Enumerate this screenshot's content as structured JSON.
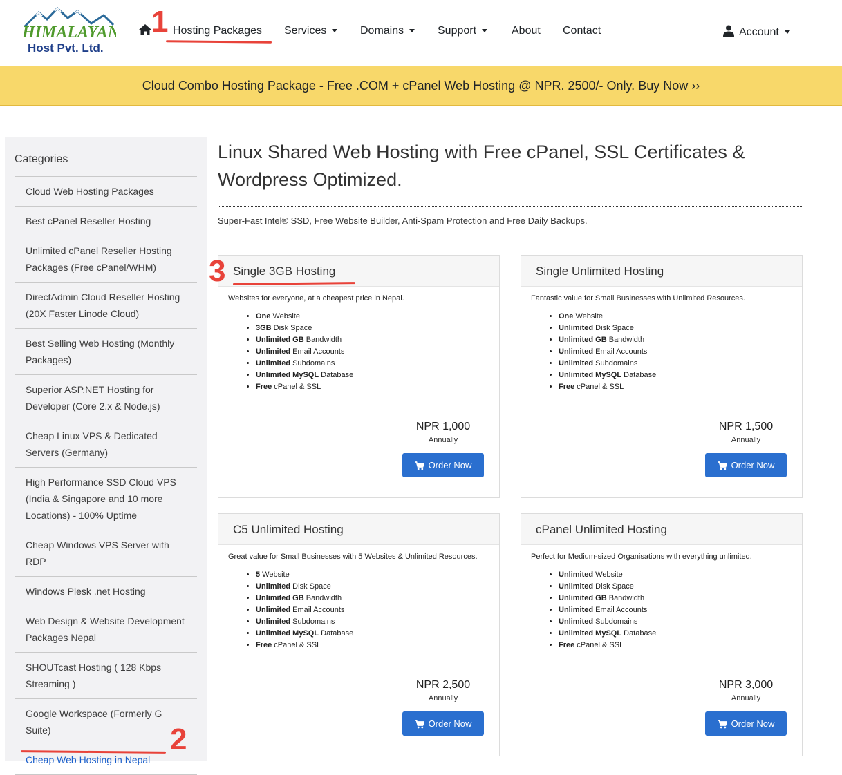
{
  "brand": {
    "logo_line1": "HIMALAYAN",
    "logo_line2": "Host Pvt. Ltd."
  },
  "nav": {
    "items": [
      {
        "label": "Hosting Packages",
        "dropdown": false
      },
      {
        "label": "Services",
        "dropdown": true
      },
      {
        "label": "Domains",
        "dropdown": true
      },
      {
        "label": "Support",
        "dropdown": true
      },
      {
        "label": "About",
        "dropdown": false
      },
      {
        "label": "Contact",
        "dropdown": false
      }
    ],
    "account": "Account",
    "home_icon": "home-icon",
    "account_icon": "user-icon"
  },
  "banner": {
    "text": "Cloud Combo Hosting Package - Free .COM + cPanel Web Hosting @ NPR. 2500/- Only. Buy Now ››"
  },
  "annotations": [
    "1",
    "2",
    "3"
  ],
  "sidebar": {
    "title": "Categories",
    "items": [
      "Cloud Web Hosting Packages",
      "Best cPanel Reseller Hosting",
      "Unlimited cPanel Reseller Hosting Packages (Free cPanel/WHM)",
      "DirectAdmin Cloud Reseller Hosting (20X Faster Linode Cloud)",
      "Best Selling Web Hosting (Monthly Packages)",
      "Superior ASP.NET Hosting for Developer (Core 2.x & Node.js)",
      "Cheap Linux VPS & Dedicated Servers (Germany)",
      "High Performance SSD Cloud VPS (India & Singapore and 10 more Locations) - 100% Uptime",
      "Cheap Windows VPS Server with RDP",
      "Windows Plesk .net Hosting",
      "Web Design & Website Development Packages Nepal",
      "SHOUTcast Hosting ( 128 Kbps Streaming )",
      "Google Workspace (Formerly G Suite)",
      "Cheap Web Hosting in Nepal"
    ],
    "active_index": 13
  },
  "main": {
    "title": "Linux Shared Web Hosting with Free cPanel, SSL Certificates & Wordpress Optimized.",
    "subtitle": "Super-Fast Intel® SSD, Free Website Builder, Anti-Spam Protection and Free Daily Backups."
  },
  "packages": [
    {
      "name": "Single 3GB Hosting",
      "desc": "Websites for everyone, at a cheapest price in Nepal.",
      "features": [
        [
          "One",
          " Website"
        ],
        [
          "3GB",
          " Disk Space"
        ],
        [
          "Unlimited GB",
          " Bandwidth"
        ],
        [
          "Unlimited",
          " Email Accounts"
        ],
        [
          "Unlimited",
          " Subdomains"
        ],
        [
          "Unlimited MySQL",
          " Database"
        ],
        [
          "Free",
          " cPanel & SSL"
        ]
      ],
      "price": "NPR 1,000",
      "cycle": "Annually",
      "button": "Order Now"
    },
    {
      "name": "Single Unlimited Hosting",
      "desc": "Fantastic value for Small Businesses with Unlimited Resources.",
      "features": [
        [
          "One",
          " Website"
        ],
        [
          "Unlimited",
          " Disk Space"
        ],
        [
          "Unlimited GB",
          " Bandwidth"
        ],
        [
          "Unlimited",
          " Email Accounts"
        ],
        [
          "Unlimited",
          " Subdomains"
        ],
        [
          "Unlimited MySQL",
          " Database"
        ],
        [
          "Free",
          " cPanel & SSL"
        ]
      ],
      "price": "NPR 1,500",
      "cycle": "Annually",
      "button": "Order Now"
    },
    {
      "name": "C5 Unlimited Hosting",
      "desc": "Great value for Small Businesses with 5 Websites & Unlimited Resources.",
      "features": [
        [
          "5",
          " Website"
        ],
        [
          "Unlimited",
          " Disk Space"
        ],
        [
          "Unlimited GB",
          " Bandwidth"
        ],
        [
          "Unlimited",
          " Email Accounts"
        ],
        [
          "Unlimited",
          " Subdomains"
        ],
        [
          "Unlimited MySQL",
          " Database"
        ],
        [
          "Free",
          " cPanel & SSL"
        ]
      ],
      "price": "NPR 2,500",
      "cycle": "Annually",
      "button": "Order Now"
    },
    {
      "name": "cPanel Unlimited Hosting",
      "desc": "Perfect for Medium-sized Organisations with everything unlimited.",
      "features": [
        [
          "Unlimited",
          " Website"
        ],
        [
          "Unlimited",
          " Disk Space"
        ],
        [
          "Unlimited GB",
          " Bandwidth"
        ],
        [
          "Unlimited",
          " Email Accounts"
        ],
        [
          "Unlimited",
          " Subdomains"
        ],
        [
          "Unlimited MySQL",
          " Database"
        ],
        [
          "Free",
          " cPanel & SSL"
        ]
      ],
      "price": "NPR 3,000",
      "cycle": "Annually",
      "button": "Order Now"
    }
  ],
  "colors": {
    "banner": "#f8d86a",
    "button": "#2a6fcf",
    "annotation": "#e8433a",
    "link": "#1a5fcb"
  }
}
